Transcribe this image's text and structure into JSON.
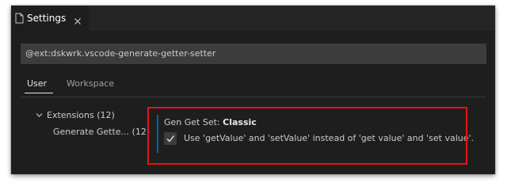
{
  "tab": {
    "label": "Settings"
  },
  "search": {
    "value": "@ext:dskwrk.vscode-generate-getter-setter"
  },
  "scope_tabs": [
    {
      "label": "User"
    },
    {
      "label": "Workspace"
    }
  ],
  "toc": {
    "extensions_label": "Extensions (12)",
    "item_label": "Generate Gette... (12)"
  },
  "setting": {
    "title_prefix": "Gen Get Set: ",
    "title_name": "Classic",
    "description": "Use 'getValue' and 'setValue' instead of 'get value' and 'set value'.",
    "checked": true
  },
  "colors": {
    "highlight": "#e8131b",
    "accent": "#0e639c"
  }
}
